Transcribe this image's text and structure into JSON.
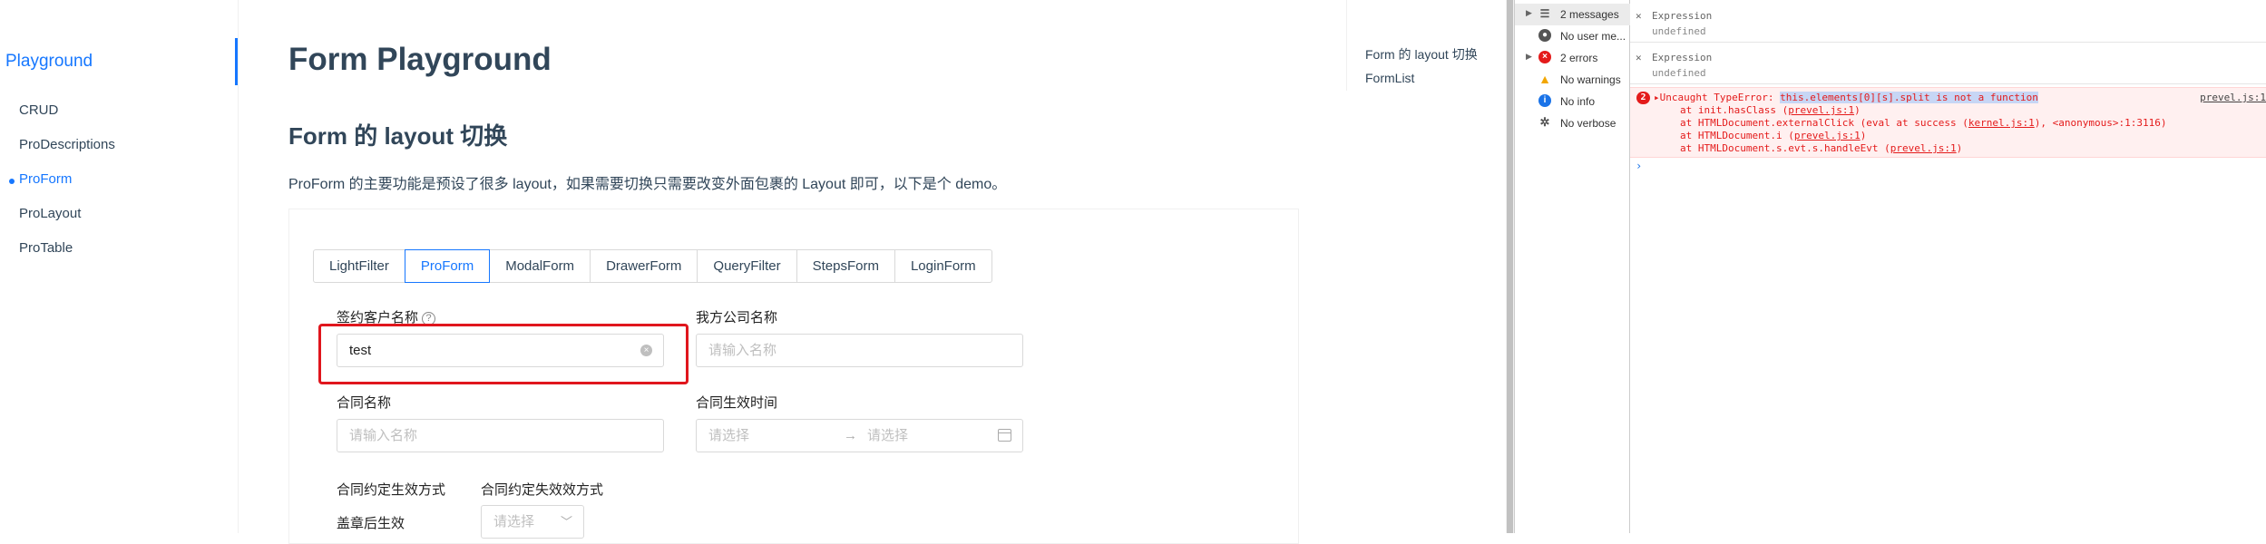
{
  "sidenav": {
    "group": "Playground",
    "items": [
      "CRUD",
      "ProDescriptions",
      "ProForm",
      "ProLayout",
      "ProTable"
    ],
    "active_index": 2
  },
  "page": {
    "title": "Form Playground",
    "section_title": "Form 的 layout 切换",
    "description": "ProForm 的主要功能是预设了很多 layout，如果需要切换只需要改变外面包裹的 Layout 即可，以下是个 demo。"
  },
  "toc": [
    "Form 的 layout 切换",
    "FormList"
  ],
  "layout_switch": {
    "options": [
      "LightFilter",
      "ProForm",
      "ModalForm",
      "DrawerForm",
      "QueryFilter",
      "StepsForm",
      "LoginForm"
    ],
    "selected": "ProForm"
  },
  "form": {
    "customer_label": "签约客户名称",
    "customer_value": "test",
    "company_label": "我方公司名称",
    "company_placeholder": "请输入名称",
    "contract_label": "合同名称",
    "contract_placeholder": "请输入名称",
    "effective_time_label": "合同生效时间",
    "start_placeholder": "请选择",
    "end_placeholder": "请选择",
    "agreed_effect_label": "合同约定生效方式",
    "agreed_effect_value": "盖章后生效",
    "agreed_invalid_label": "合同约定失效效方式",
    "agreed_invalid_placeholder": "请选择"
  },
  "devtools": {
    "sidebar": [
      {
        "label": "2 messages",
        "icon": "list-icon",
        "selected": true,
        "expandable": true
      },
      {
        "label": "No user me...",
        "icon": "user-icon",
        "selected": false,
        "expandable": false
      },
      {
        "label": "2 errors",
        "icon": "error-icon",
        "selected": false,
        "expandable": true
      },
      {
        "label": "No warnings",
        "icon": "warning-icon",
        "selected": false,
        "expandable": false
      },
      {
        "label": "No info",
        "icon": "info-icon",
        "selected": false,
        "expandable": false
      },
      {
        "label": "No verbose",
        "icon": "bug-icon",
        "selected": false,
        "expandable": false
      }
    ],
    "expressions": [
      {
        "title": "Expression",
        "value": "undefined"
      },
      {
        "title": "Expression",
        "value": "undefined"
      }
    ],
    "error": {
      "count": "2",
      "prefix": "Uncaught TypeError: ",
      "message": "this.elements[0][s].split is not a function",
      "source": "prevel.js:1",
      "stack": [
        {
          "pre": "at init.hasClass (",
          "link": "prevel.js:1",
          "post": ")"
        },
        {
          "pre": "at HTMLDocument.externalClick (eval at success (",
          "link": "kernel.js:1",
          "post": "), <anonymous>:1:3116)"
        },
        {
          "pre": "at HTMLDocument.i (",
          "link": "prevel.js:1",
          "post": ")"
        },
        {
          "pre": "at HTMLDocument.s.evt.s.handleEvt (",
          "link": "prevel.js:1",
          "post": ")"
        }
      ]
    },
    "prompt": "›"
  },
  "colors": {
    "accent": "#1677ff",
    "error": "#e41b1b",
    "highlight": "#e0161d"
  }
}
